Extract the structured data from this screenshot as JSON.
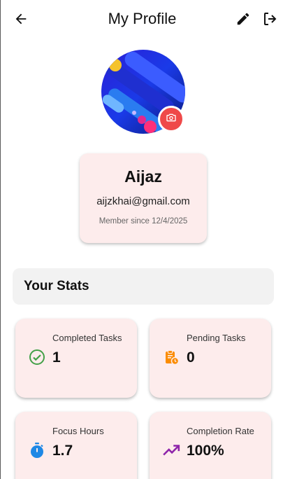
{
  "header": {
    "title": "My Profile",
    "back_icon": "arrow-back-icon",
    "edit_icon": "pencil-icon",
    "logout_icon": "logout-icon"
  },
  "profile": {
    "name": "Aijaz",
    "email": "aijzkhai@gmail.com",
    "member_since": "Member since 12/4/2025",
    "camera_icon": "camera-icon"
  },
  "stats": {
    "heading": "Your Stats",
    "cards": [
      {
        "label": "Completed Tasks",
        "value": "1",
        "icon": "check-circle-icon",
        "color": "#43a047"
      },
      {
        "label": "Pending Tasks",
        "value": "0",
        "icon": "clipboard-clock-icon",
        "color": "#fb8c00"
      },
      {
        "label": "Focus Hours",
        "value": "1.7",
        "icon": "stopwatch-icon",
        "color": "#1e88e5"
      },
      {
        "label": "Completion Rate",
        "value": "100%",
        "icon": "trending-up-icon",
        "color": "#8e24aa"
      }
    ]
  },
  "colors": {
    "card_bg": "#fdecec",
    "camera_badge": "#ef4949",
    "stats_header_bg": "#f2f2f2"
  }
}
